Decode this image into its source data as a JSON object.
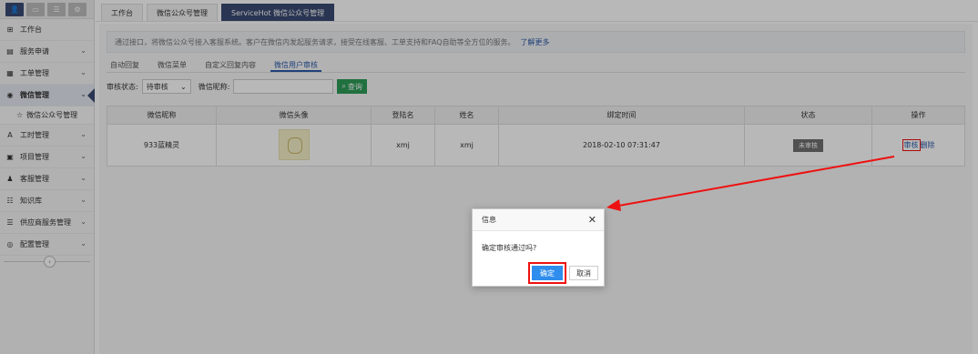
{
  "sidebar": {
    "toolbar": [
      "👤",
      "▭",
      "☰",
      "⚙"
    ],
    "items": [
      {
        "icon": "⊞",
        "label": "工作台",
        "chevron": false
      },
      {
        "icon": "▤",
        "label": "服务申请",
        "chevron": true
      },
      {
        "icon": "▦",
        "label": "工单管理",
        "chevron": true
      },
      {
        "icon": "◉",
        "label": "微信管理",
        "chevron": true,
        "active": true
      },
      {
        "icon": "☆",
        "label": "微信公众号管理",
        "sub": true
      },
      {
        "icon": "A",
        "label": "工时管理",
        "chevron": true
      },
      {
        "icon": "▣",
        "label": "项目管理",
        "chevron": true
      },
      {
        "icon": "♟",
        "label": "客服管理",
        "chevron": true
      },
      {
        "icon": "☷",
        "label": "知识库",
        "chevron": true
      },
      {
        "icon": "☰",
        "label": "供应商服务管理",
        "chevron": true
      },
      {
        "icon": "◎",
        "label": "配置管理",
        "chevron": true
      }
    ],
    "collapse": "‹"
  },
  "tabs": [
    {
      "label": "工作台"
    },
    {
      "label": "微信公众号管理"
    },
    {
      "label": "ServiceHot 微信公众号管理",
      "active": true
    }
  ],
  "notice": {
    "text": "通过接口，将微信公众号接入客服系统。客户在微信内发起服务请求，接受在线客服、工单支持和FAQ自助等全方位的服务。",
    "more": "了解更多"
  },
  "subtabs": [
    "自动回复",
    "微信菜单",
    "自定义回复内容",
    "微信用户审核"
  ],
  "filters": {
    "status_label": "审核状态:",
    "status_value": "待审核",
    "nickname_label": "微信昵称:",
    "nickname_value": "",
    "query": "查询"
  },
  "table": {
    "headers": [
      "微信昵称",
      "微信头像",
      "登陆名",
      "姓名",
      "绑定时间",
      "状态",
      "操作"
    ],
    "row": {
      "nickname": "933蓝精灵",
      "login": "xmj",
      "name": "xmj",
      "bind_time": "2018-02-10 07:31:47",
      "status": "未审核",
      "approve": "审核",
      "delete": "删除"
    }
  },
  "dialog": {
    "title": "信息",
    "message": "确定审核通过吗?",
    "ok": "确定",
    "cancel": "取消",
    "close": "✕"
  },
  "colors": {
    "accent": "#3a4a72",
    "link": "#2b5aa8",
    "highlight": "#e11111",
    "ok": "#2e8ded",
    "query": "#2e9b58"
  }
}
